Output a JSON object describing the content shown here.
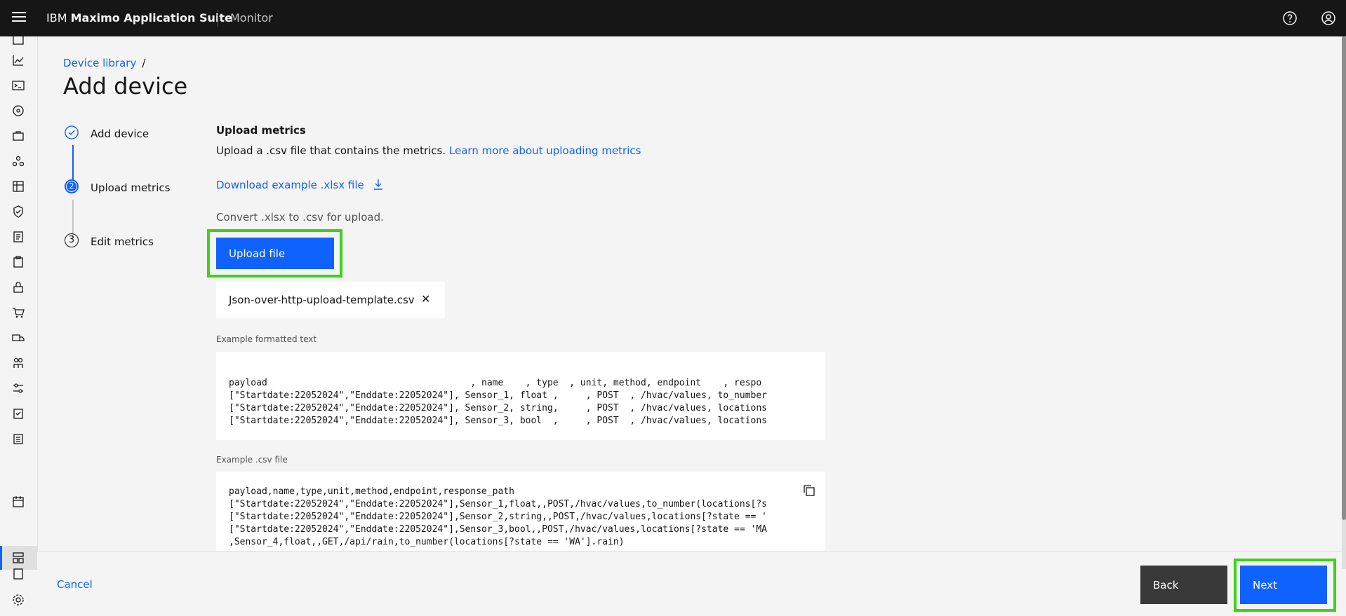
{
  "header": {
    "brand_prefix": "IBM",
    "brand_name": "Maximo Application Suite",
    "product": "Monitor",
    "icons": [
      "menu-icon",
      "help-icon",
      "user-avatar-icon"
    ]
  },
  "sidenav": {
    "icons": [
      "dashboard-icon",
      "chart-line-icon",
      "terminal-icon",
      "network-icon",
      "briefcase-icon",
      "group-icon",
      "table-icon",
      "shield-check-icon",
      "receipt-icon",
      "clipboard-icon",
      "lock-icon",
      "cart-icon",
      "delivery-icon",
      "people-icon",
      "settings-adjust-icon",
      "checklist-icon",
      "task-icon",
      "calendar-icon",
      "device-template-icon",
      "model-icon",
      "gear-icon"
    ]
  },
  "breadcrumb": {
    "link": "Device library",
    "separator": "/"
  },
  "page": {
    "title": "Add device"
  },
  "steps": [
    {
      "number": "1",
      "label": "Add device",
      "state": "complete"
    },
    {
      "number": "2",
      "label": "Upload metrics",
      "state": "current"
    },
    {
      "number": "3",
      "label": "Edit metrics",
      "state": "incomplete"
    }
  ],
  "upload": {
    "heading": "Upload metrics",
    "description": "Upload a .csv file that contains the metrics.",
    "learn_more": "Learn more about uploading metrics",
    "download_link": "Download example .xlsx file",
    "convert_note": "Convert .xlsx to .csv for upload.",
    "upload_button": "Upload file",
    "file_name": "Json-over-http-upload-template.csv",
    "remove_glyph": "✕"
  },
  "formatted_example": {
    "label": "Example formatted text",
    "lines": [
      "payload                                     , name    , type  , unit, method, endpoint    , respo",
      "[\"Startdate:22052024\",\"Enddate:22052024\"], Sensor_1, float ,     , POST  , /hvac/values, to_number",
      "[\"Startdate:22052024\",\"Enddate:22052024\"], Sensor_2, string,     , POST  , /hvac/values, locations",
      "[\"Startdate:22052024\",\"Enddate:22052024\"], Sensor_3, bool  ,     , POST  , /hvac/values, locations"
    ]
  },
  "csv_example": {
    "label": "Example .csv file",
    "lines": [
      "payload,name,type,unit,method,endpoint,response_path",
      "[\"Startdate:22052024\",\"Enddate:22052024\"],Sensor_1,float,,POST,/hvac/values,to_number(locations[?s",
      "[\"Startdate:22052024\",\"Enddate:22052024\"],Sensor_2,string,,POST,/hvac/values,locations[?state == '",
      "[\"Startdate:22052024\",\"Enddate:22052024\"],Sensor_3,bool,,POST,/hvac/values,locations[?state == 'MA",
      ",Sensor_4,float,,GET,/api/rain,to_number(locations[?state == 'WA'].rain)"
    ]
  },
  "footer": {
    "cancel": "Cancel",
    "back": "Back",
    "next": "Next"
  },
  "colors": {
    "primary": "#0f62fe",
    "header_bg": "#161616",
    "highlight": "#3bd416",
    "secondary_btn": "#393939"
  }
}
